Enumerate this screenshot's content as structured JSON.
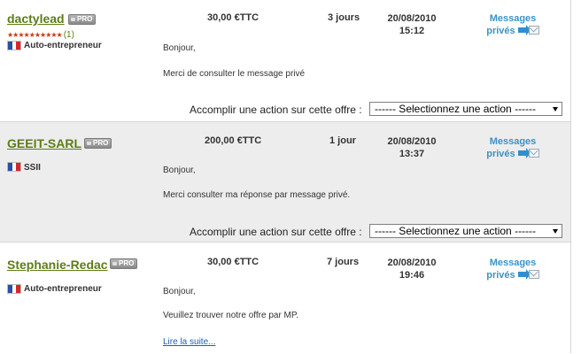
{
  "offers": [
    {
      "username": "dactylead",
      "pro_badge": "PRO",
      "stars": "★★★★★★★★★★",
      "rating_count": "(1)",
      "status": "Auto-entrepreneur",
      "price": "30,00 €TTC",
      "delay": "3 jours",
      "date": "20/08/2010",
      "time": "15:12",
      "messages_line1": "Messages",
      "messages_line2": "privés",
      "greeting": "Bonjour,",
      "message": "Merci de consulter le message privé",
      "action_label": "Accomplir une action sur cette offre :",
      "action_select": "------ Selectionnez une action ------"
    },
    {
      "username": "GEEIT-SARL",
      "pro_badge": "PRO",
      "status": "SSII",
      "price": "200,00 €TTC",
      "delay": "1 jour",
      "date": "20/08/2010",
      "time": "13:37",
      "messages_line1": "Messages",
      "messages_line2": "privés",
      "greeting": "Bonjour,",
      "message": "Merci consulter ma réponse par message privé.",
      "action_label": "Accomplir une action sur cette offre :",
      "action_select": "------ Selectionnez une action ------"
    },
    {
      "username": "Stephanie-Redac",
      "pro_badge": "PRO",
      "status": "Auto-entrepreneur",
      "price": "30,00 €TTC",
      "delay": "7 jours",
      "date": "20/08/2010",
      "time": "19:46",
      "messages_line1": "Messages",
      "messages_line2": "privés",
      "greeting": "Bonjour,",
      "message": "Veuillez trouver notre offre par MP.",
      "read_more": "Lire la suite..."
    }
  ],
  "colors": {
    "username": "#5e7d16",
    "messages_link": "#3a93c7",
    "read_more_link": "#1a5fb4",
    "alt_row_background": "#ededed",
    "stars": "#c93a0c"
  },
  "icons": {
    "country_flag": "france-flag-icon",
    "private_message": "envelope-arrow-icon"
  }
}
